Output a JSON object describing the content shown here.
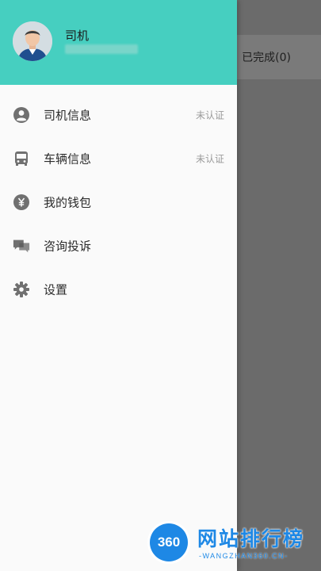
{
  "background": {
    "tab_completed": "已完成(0)"
  },
  "drawer": {
    "header": {
      "user_name": "司机",
      "accent_color": "#46cfc0"
    },
    "menu": [
      {
        "label": "司机信息",
        "status": "未认证",
        "icon": "person-icon"
      },
      {
        "label": "车辆信息",
        "status": "未认证",
        "icon": "bus-icon"
      },
      {
        "label": "我的钱包",
        "status": "",
        "icon": "yuan-coin-icon"
      },
      {
        "label": "咨询投诉",
        "status": "",
        "icon": "chat-bubbles-icon"
      },
      {
        "label": "设置",
        "status": "",
        "icon": "gear-icon"
      }
    ]
  },
  "watermark": {
    "badge": "360",
    "title": "网站排行榜",
    "subtitle": "-WANGZHAN360.CN-"
  }
}
